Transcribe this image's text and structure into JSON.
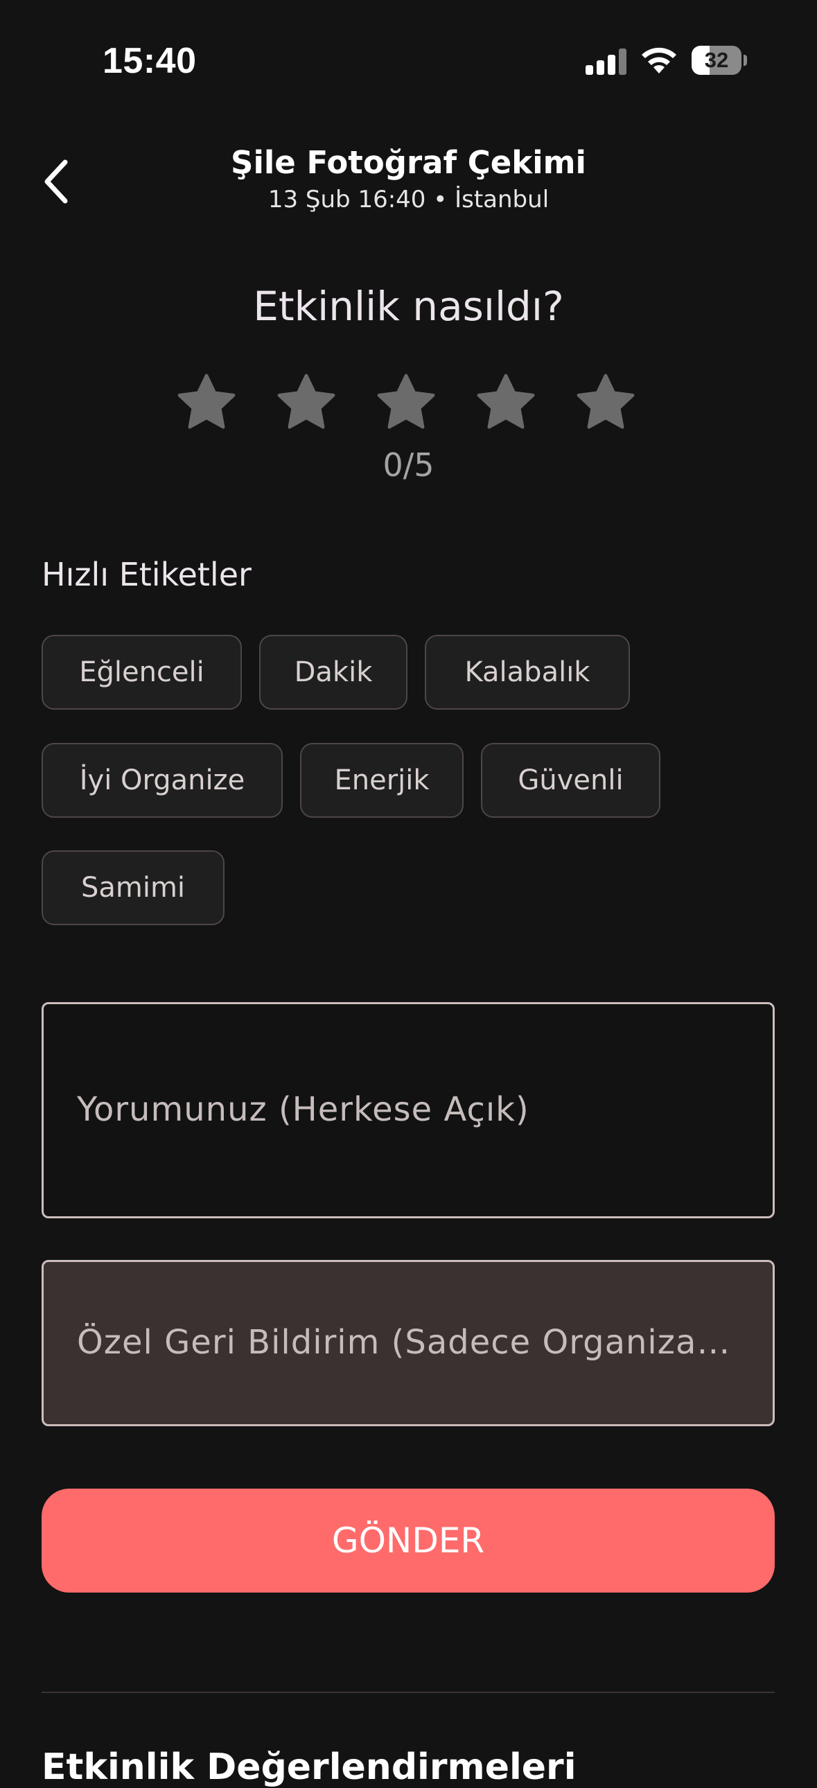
{
  "status_bar": {
    "time": "15:40",
    "battery": "32"
  },
  "header": {
    "title": "Şile Fotoğraf Çekimi",
    "subtitle": "13 Şub 16:40 • İstanbul"
  },
  "rating": {
    "question": "Etkinlik nasıldı?",
    "value": 0,
    "max": 5,
    "display": "0/5",
    "star_color": "#6b6b6b"
  },
  "quick_tags": {
    "label": "Hızlı Etiketler",
    "items": [
      {
        "label": "Eğlenceli"
      },
      {
        "label": "Dakik"
      },
      {
        "label": "Kalabalık"
      },
      {
        "label": "İyi Organize"
      },
      {
        "label": "Enerjik"
      },
      {
        "label": "Güvenli"
      },
      {
        "label": "Samimi"
      }
    ]
  },
  "comment": {
    "placeholder": "Yorumunuz (Herkese Açık)",
    "value": ""
  },
  "private_feedback": {
    "placeholder": "Özel Geri Bildirim (Sadece Organizat…",
    "value": ""
  },
  "submit": {
    "label": "GÖNDER",
    "color": "#ff6b6b"
  },
  "reviews": {
    "title": "Etkinlik Değerlendirmeleri"
  }
}
